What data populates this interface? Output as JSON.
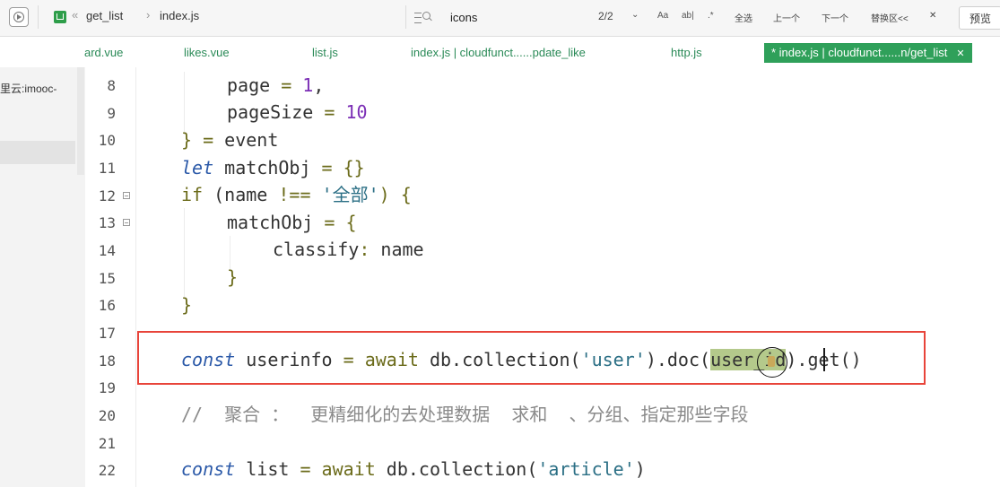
{
  "toolbar": {
    "crumb_folder": "get_list",
    "crumb_file": "index.js",
    "crumb_back": "«",
    "crumb_sep": "›",
    "search_value": "icons",
    "find_count": "2/2",
    "find_chevron": "⌄",
    "opt_case": "Aa",
    "opt_word": "ab|",
    "opt_regex": ".*",
    "select_all": "全选",
    "prev": "上一个",
    "next": "下一个",
    "replace": "替换区<<",
    "close": "✕",
    "preview": "预览"
  },
  "tabs": [
    {
      "label": "ard.vue"
    },
    {
      "label": "likes.vue"
    },
    {
      "label": "list.js"
    },
    {
      "label": "index.js | cloudfunct......pdate_like"
    },
    {
      "label": "http.js"
    },
    {
      "label": "* index.js | cloudfunct......n/get_list",
      "close": "✕"
    }
  ],
  "sidebar": {
    "text": "里云:imooc-"
  },
  "editor": {
    "line_numbers": [
      "8",
      "9",
      "10",
      "11",
      "12",
      "13",
      "14",
      "15",
      "16",
      "17",
      "18",
      "19",
      "20",
      "21",
      "22"
    ],
    "lines": {
      "l8": {
        "a": "page",
        "b": " = ",
        "c": "1",
        "d": ","
      },
      "l9": {
        "a": "pageSize",
        "b": " = ",
        "c": "10"
      },
      "l10": {
        "a": "}",
        "b": " = ",
        "c": "event"
      },
      "l11": {
        "a": "let",
        "b": " matchObj ",
        "c": "=",
        "d": " {}"
      },
      "l12": {
        "a": "if",
        "b": " (name ",
        "c": "!==",
        "d": " ",
        "e": "'全部'",
        "f": ") {"
      },
      "l13": {
        "a": "matchObj",
        "b": " = ",
        "c": "{"
      },
      "l14": {
        "a": "classify",
        "b": ": ",
        "c": "name"
      },
      "l15": {
        "a": "}"
      },
      "l16": {
        "a": "}"
      },
      "l18": {
        "a": "const",
        "b": " userinfo ",
        "c": "=",
        "d": " await",
        "e": " db.collection(",
        "f": "'user'",
        "g": ").doc(",
        "h": "user_id",
        "i": ").get()"
      },
      "l20": {
        "a": "//  聚合 ：  更精细化的去处理数据  求和  、分组、指定那些字段"
      },
      "l22": {
        "a": "const",
        "b": " list ",
        "c": "=",
        "d": " await",
        "e": " db.collection(",
        "f": "'article'",
        "g": ")"
      }
    }
  }
}
